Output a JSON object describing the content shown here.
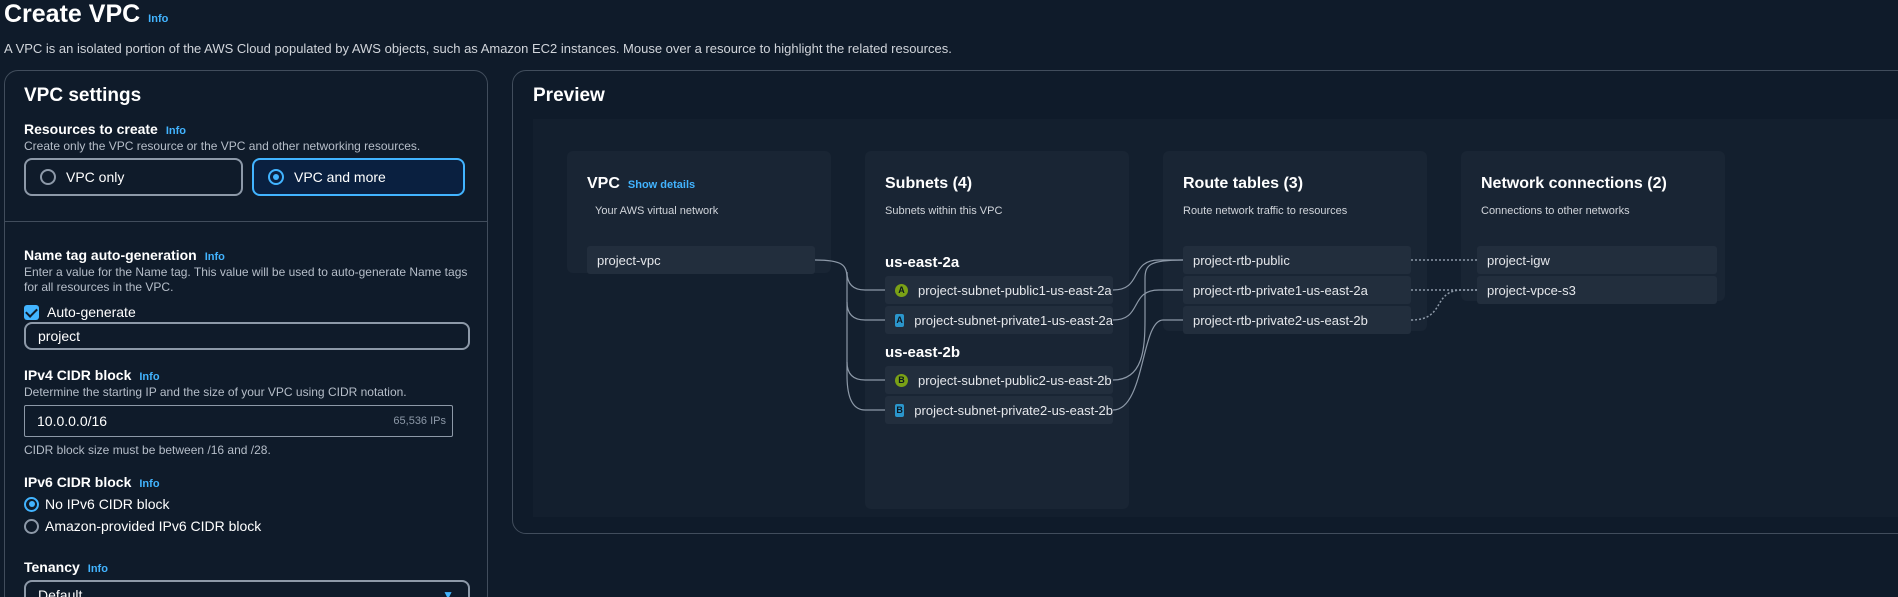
{
  "header": {
    "title": "Create VPC",
    "info": "Info",
    "description": "A VPC is an isolated portion of the AWS Cloud populated by AWS objects, such as Amazon EC2 instances. Mouse over a resource to highlight the related resources."
  },
  "settings": {
    "title": "VPC settings",
    "resources": {
      "label": "Resources to create",
      "info": "Info",
      "hint": "Create only the VPC resource or the VPC and other networking resources.",
      "option_vpc_only": "VPC only",
      "option_vpc_and_more": "VPC and more",
      "selected": "VPC and more"
    },
    "name_tag": {
      "label": "Name tag auto-generation",
      "info": "Info",
      "hint": "Enter a value for the Name tag. This value will be used to auto-generate Name tags for all resources in the VPC.",
      "checkbox_label": "Auto-generate",
      "checked": true,
      "value": "project"
    },
    "ipv4": {
      "label": "IPv4 CIDR block",
      "info": "Info",
      "hint": "Determine the starting IP and the size of your VPC using CIDR notation.",
      "value": "10.0.0.0/16",
      "ip_count": "65,536 IPs",
      "constraint": "CIDR block size must be between /16 and /28."
    },
    "ipv6": {
      "label": "IPv6 CIDR block",
      "info": "Info",
      "option_none": "No IPv6 CIDR block",
      "option_amazon": "Amazon-provided IPv6 CIDR block",
      "selected": "No IPv6 CIDR block"
    },
    "tenancy": {
      "label": "Tenancy",
      "info": "Info",
      "value": "Default"
    }
  },
  "preview": {
    "title": "Preview",
    "vpc": {
      "title": "VPC",
      "link": "Show details",
      "subtitle": "Your AWS virtual network",
      "name": "project-vpc"
    },
    "subnets": {
      "title": "Subnets (4)",
      "subtitle": "Subnets within this VPC",
      "az1": "us-east-2a",
      "az2": "us-east-2b",
      "items": [
        {
          "badge": "A",
          "type": "public",
          "name": "project-subnet-public1-us-east-2a"
        },
        {
          "badge": "A",
          "type": "private",
          "name": "project-subnet-private1-us-east-2a"
        },
        {
          "badge": "B",
          "type": "public",
          "name": "project-subnet-public2-us-east-2b"
        },
        {
          "badge": "B",
          "type": "private",
          "name": "project-subnet-private2-us-east-2b"
        }
      ]
    },
    "route_tables": {
      "title": "Route tables (3)",
      "subtitle": "Route network traffic to resources",
      "items": [
        "project-rtb-public",
        "project-rtb-private1-us-east-2a",
        "project-rtb-private2-us-east-2b"
      ]
    },
    "network": {
      "title": "Network connections (2)",
      "subtitle": "Connections to other networks",
      "items": [
        "project-igw",
        "project-vpce-s3"
      ]
    }
  },
  "colors": {
    "background": "#0f1b2a",
    "accent": "#42b4ff",
    "public_badge": "#7aa116",
    "private_badge": "#2b96cc"
  }
}
